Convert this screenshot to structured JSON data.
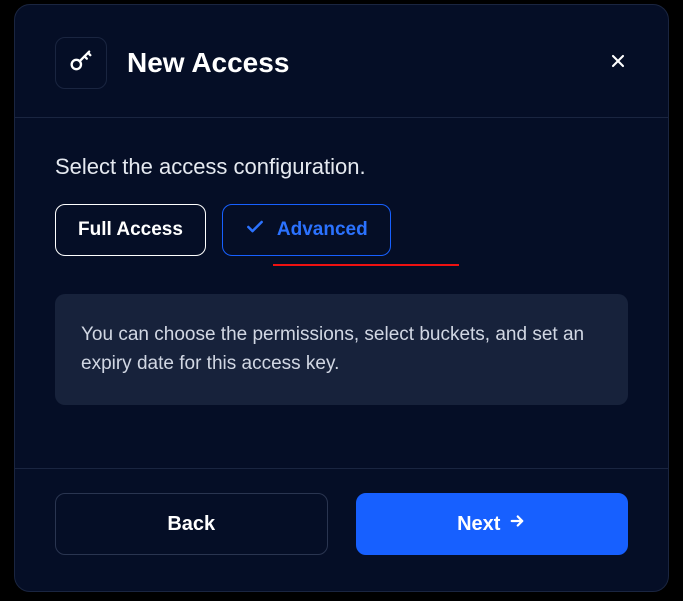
{
  "header": {
    "title": "New Access"
  },
  "body": {
    "subtitle": "Select the access configuration.",
    "options": {
      "full": "Full Access",
      "advanced": "Advanced"
    },
    "info": "You can choose the permissions, select buckets, and set an expiry date for this access key."
  },
  "footer": {
    "back": "Back",
    "next": "Next"
  }
}
